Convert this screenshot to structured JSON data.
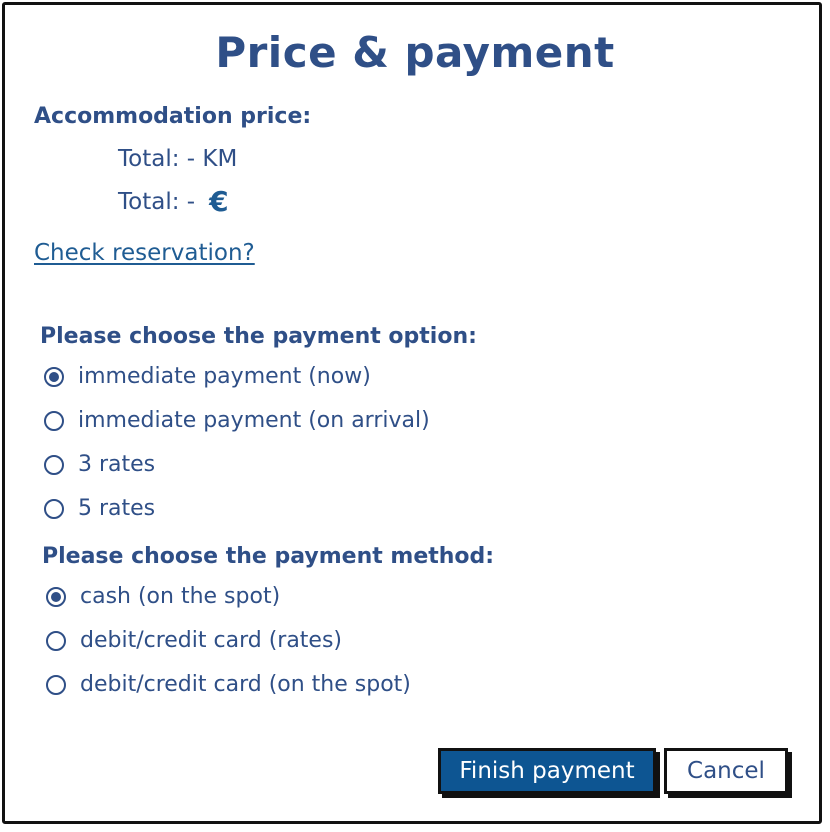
{
  "dialog": {
    "title": "Price & payment"
  },
  "price": {
    "label": "Accommodation price:",
    "total_km": "Total: - KM",
    "total_eur_prefix": "Total: -",
    "euro_symbol": "€"
  },
  "check_reservation": {
    "label": "Check reservation?"
  },
  "payment_option": {
    "label": "Please choose the payment option:",
    "options": [
      {
        "label": "immediate payment (now)",
        "checked": true
      },
      {
        "label": "immediate payment (on arrival)",
        "checked": false
      },
      {
        "label": "3 rates",
        "checked": false
      },
      {
        "label": "5 rates",
        "checked": false
      }
    ]
  },
  "payment_method": {
    "label": "Please choose the payment method:",
    "options": [
      {
        "label": "cash (on the spot)",
        "checked": true
      },
      {
        "label": "debit/credit card (rates)",
        "checked": false
      },
      {
        "label": "debit/credit card (on the spot)",
        "checked": false
      }
    ]
  },
  "buttons": {
    "finish": "Finish payment",
    "cancel": "Cancel"
  },
  "colors": {
    "text": "#2f4f87",
    "accent": "#0d5592",
    "link": "#1f5c93",
    "border": "#111111"
  }
}
